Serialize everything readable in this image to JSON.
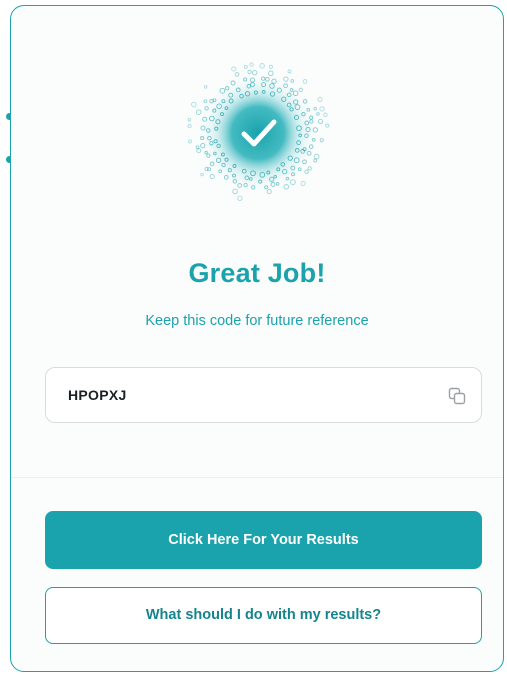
{
  "colors": {
    "accent": "#1aa3ac",
    "accent_dark": "#14858d",
    "border": "#d8dcde",
    "text": "#1b2024"
  },
  "badge": {
    "icon": "check-icon"
  },
  "heading": {
    "title": "Great Job!",
    "subtitle": "Keep this code for future reference"
  },
  "code_field": {
    "value": "HPOPXJ",
    "icon": "copy-icon"
  },
  "actions": {
    "primary_label": "Click Here For Your Results",
    "secondary_label": "What should I do with my results?"
  }
}
